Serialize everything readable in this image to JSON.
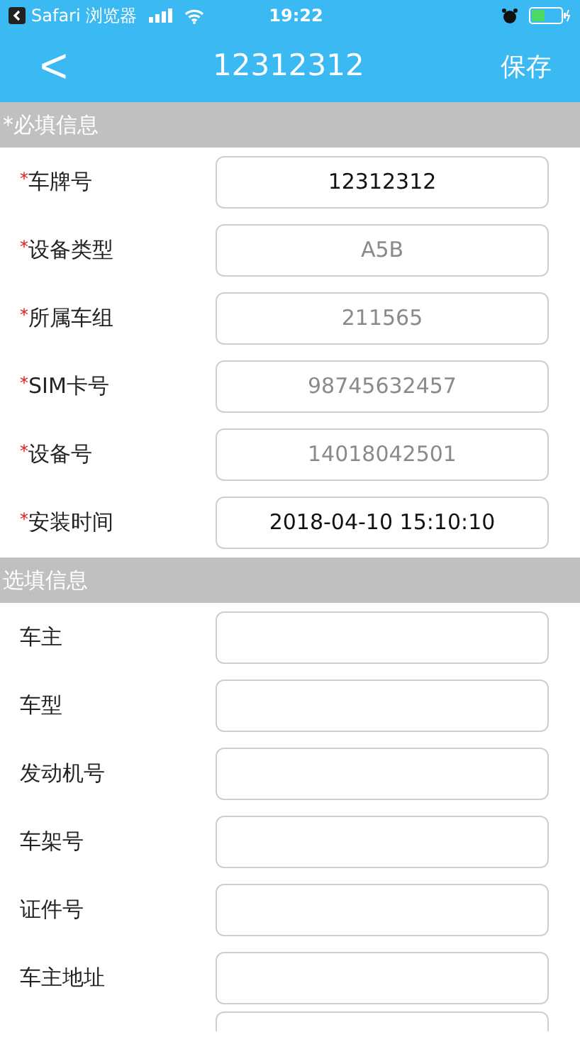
{
  "status_bar": {
    "back_app": "Safari 浏览器",
    "time": "19:22"
  },
  "nav_bar": {
    "back": "<",
    "title": "12312312",
    "action": "保存"
  },
  "sections": [
    {
      "title": "*必填信息",
      "rows": [
        {
          "kind": "full",
          "mark": "*",
          "label": "车牌号",
          "value": "12312312",
          "disabled": false
        },
        {
          "kind": "full",
          "mark": "*",
          "label": "设备类型",
          "value": "A5B",
          "disabled": true
        },
        {
          "kind": "full",
          "mark": "*",
          "label": "所属车组",
          "value": "211565",
          "disabled": true
        },
        {
          "kind": "full",
          "mark": "*",
          "label": "SIM卡号",
          "value": "98745632457",
          "disabled": true
        },
        {
          "kind": "full",
          "mark": "*",
          "label": "设备号",
          "value": "14018042501",
          "disabled": true
        },
        {
          "kind": "full",
          "mark": "*",
          "label": "安装时间",
          "value": "2018-04-10 15:10:10",
          "disabled": false
        }
      ]
    },
    {
      "title": "选填信息",
      "rows": [
        {
          "kind": "full",
          "label": "车主"
        },
        {
          "kind": "full",
          "label": "车型"
        },
        {
          "kind": "full",
          "label": "发动机号"
        },
        {
          "kind": "full",
          "label": "车架号"
        },
        {
          "kind": "full",
          "label": "证件号"
        },
        {
          "kind": "full",
          "label": "车主地址"
        },
        {
          "kind": "cut"
        }
      ]
    }
  ]
}
